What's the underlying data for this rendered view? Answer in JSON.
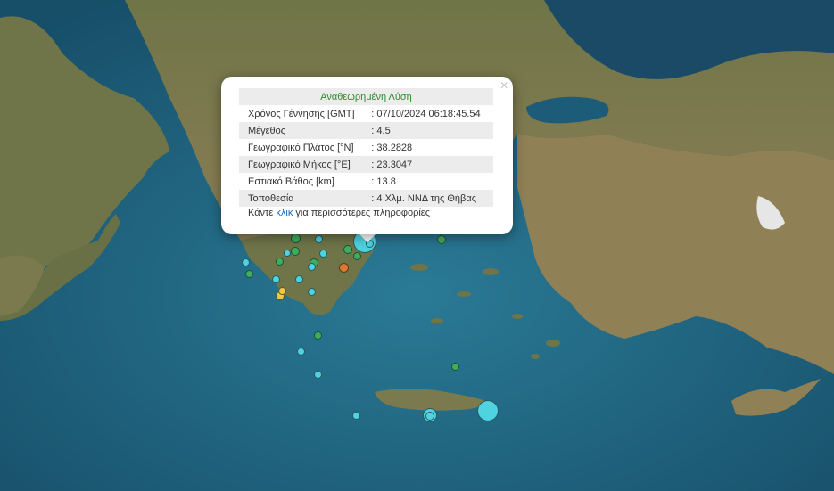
{
  "popup": {
    "title": "Αναθεωρημένη Λύση",
    "close_symbol": "×",
    "rows": [
      {
        "label": "Χρόνος Γέννησης [GMT]",
        "value": ": 07/10/2024 06:18:45.54"
      },
      {
        "label": "Μέγεθος",
        "value": ": 4.5"
      },
      {
        "label": "Γεωγραφικό Πλάτος [°N]",
        "value": ": 38.2828"
      },
      {
        "label": "Γεωγραφικό Μήκος [°E]",
        "value": ": 23.3047"
      },
      {
        "label": "Εστιακό Βάθος [km]",
        "value": ": 13.8"
      },
      {
        "label": "Τοποθεσία",
        "value": ": 4 Χλμ. ΝΝΔ της Θήβας"
      }
    ],
    "footer_before": "Κάντε",
    "footer_link": "κλικ",
    "footer_after": "για περισσότερες πληροφορίες"
  },
  "colors": {
    "sea": "#1f5f7a",
    "land": "#7a7a4e",
    "quake_cyan": "#4fd3e0",
    "quake_green": "#3fae5c",
    "quake_orange": "#e0772c",
    "quake_yellow": "#f0c840"
  }
}
